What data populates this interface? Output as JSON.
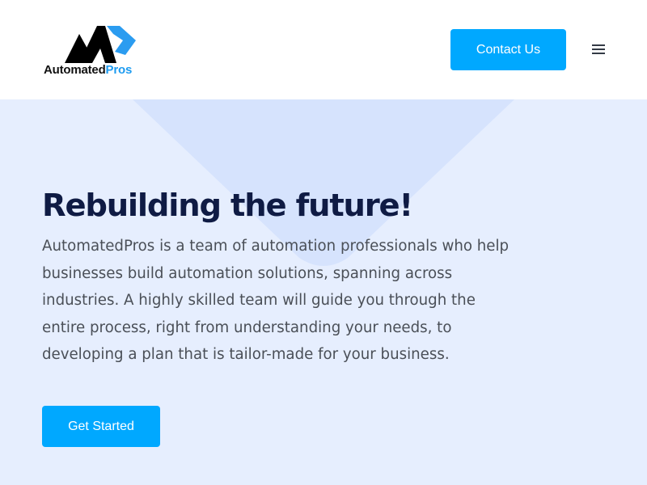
{
  "header": {
    "logo": {
      "text_main": "Automated",
      "text_accent": "Pros"
    },
    "contact_label": "Contact Us",
    "menu_icon": "hamburger-menu-icon"
  },
  "hero": {
    "title": "Rebuilding the future!",
    "description": "AutomatedPros is a team of automation professionals who help businesses build automation solutions, spanning across industries. A highly skilled team will guide you through the entire process, right from understanding your needs, to developing a plan that is tailor-made for your business.",
    "cta_label": "Get Started"
  },
  "colors": {
    "accent": "#00a8ff",
    "hero_background": "#e6eefe",
    "heading": "#0f1b44",
    "body_text": "#4a4f57"
  }
}
